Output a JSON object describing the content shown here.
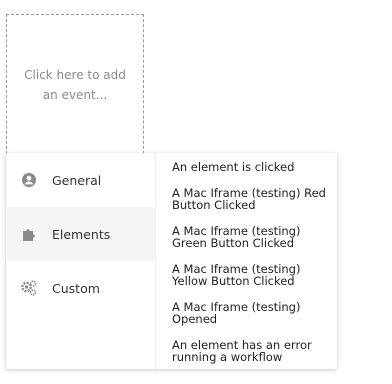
{
  "add_event": {
    "label": "Click here to add an event..."
  },
  "categories": [
    {
      "label": "General",
      "icon": "user-circle-icon"
    },
    {
      "label": "Elements",
      "icon": "puzzle-piece-icon"
    },
    {
      "label": "Custom",
      "icon": "gears-icon"
    }
  ],
  "active_category": "Elements",
  "events": [
    "An element is clicked",
    "A Mac Iframe (testing) Red Button Clicked",
    "A Mac Iframe (testing) Green Button Clicked",
    "A Mac Iframe (testing) Yellow Button Clicked",
    "A Mac Iframe (testing) Opened",
    "An element has an error running a workflow"
  ],
  "colors": {
    "icon": "#888888",
    "active_bg": "#f5f5f5",
    "border_dashed": "#9a9a9a"
  }
}
